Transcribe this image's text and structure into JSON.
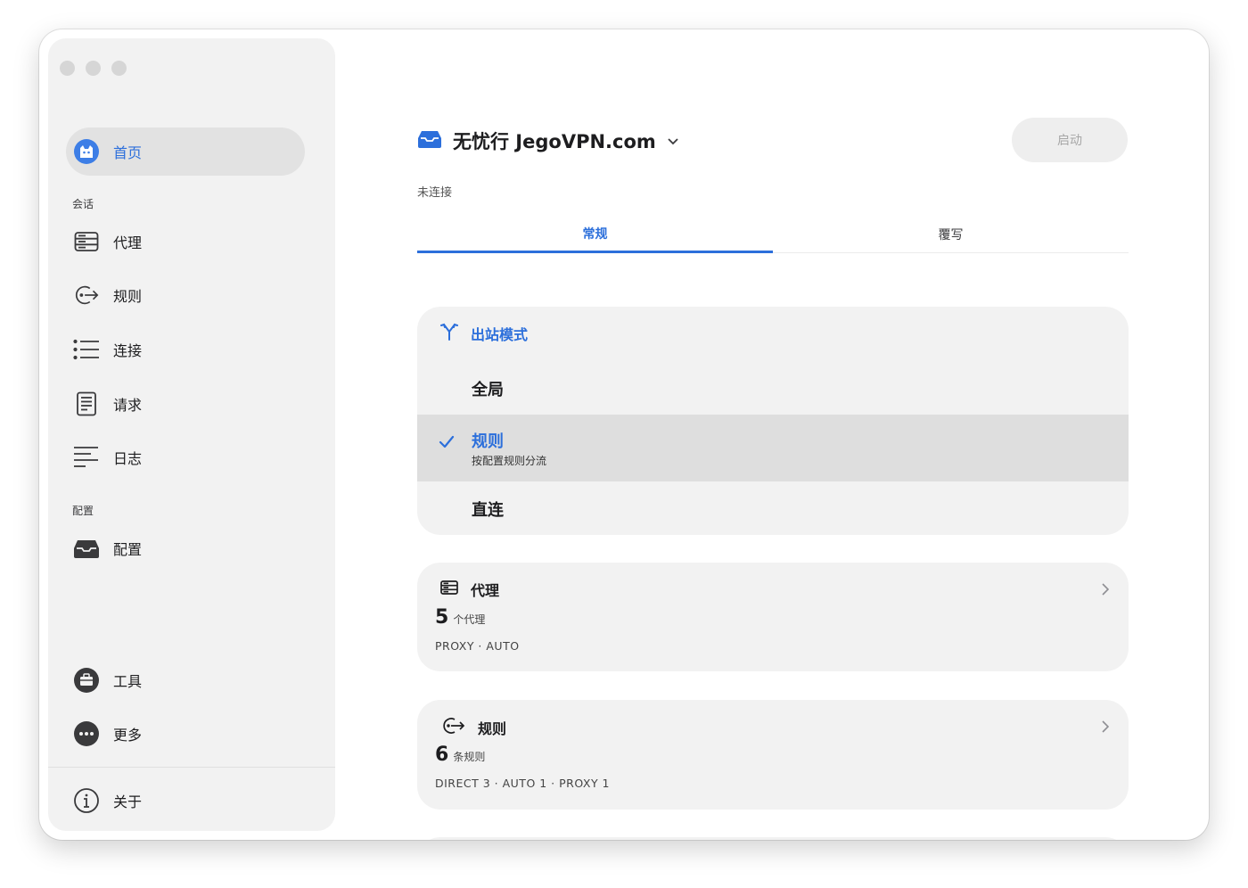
{
  "sidebar": {
    "home": "首页",
    "section_session": "会话",
    "items_session": [
      {
        "label": "代理",
        "icon": "server-icon"
      },
      {
        "label": "规则",
        "icon": "rule-route-icon"
      },
      {
        "label": "连接",
        "icon": "list-icon"
      },
      {
        "label": "请求",
        "icon": "document-icon"
      },
      {
        "label": "日志",
        "icon": "log-lines-icon"
      }
    ],
    "section_config": "配置",
    "config_item": "配置",
    "tools": "工具",
    "more": "更多",
    "about": "关于"
  },
  "header": {
    "profile_name": "无忧行 JegoVPN.com",
    "start_label": "启动",
    "status": "未连接"
  },
  "tabs": [
    {
      "label": "常规",
      "active": true
    },
    {
      "label": "覆写",
      "active": false
    }
  ],
  "outbound": {
    "title": "出站模式",
    "modes": [
      {
        "label": "全局",
        "desc": ""
      },
      {
        "label": "规则",
        "desc": "按配置规则分流",
        "selected": true
      },
      {
        "label": "直连",
        "desc": ""
      }
    ]
  },
  "proxy_card": {
    "title": "代理",
    "count": "5",
    "unit": "个代理",
    "summary": "PROXY · AUTO"
  },
  "rules_card": {
    "title": "规则",
    "count": "6",
    "unit": "条规则",
    "summary": "DIRECT 3 · AUTO 1 · PROXY 1"
  },
  "colors": {
    "accent": "#2c6fdb",
    "sidebar_bg": "#f2f2f2",
    "card_bg": "#f2f2f2",
    "selected_row": "#dedede"
  }
}
